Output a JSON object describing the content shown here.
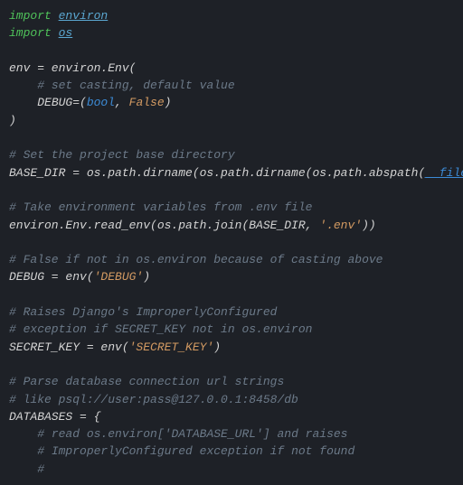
{
  "code": {
    "l1_import": "import",
    "l1_mod": "environ",
    "l2_import": "import",
    "l2_mod": "os",
    "l4_a": "env = environ.Env(",
    "l5_comment": "# set casting, default value",
    "l6_a": "DEBUG=(",
    "l6_bool": "bool",
    "l6_sep": ", ",
    "l6_false": "False",
    "l6_close": ")",
    "l7_close": ")",
    "l9_comment": "# Set the project base directory",
    "l10_a": "BASE_DIR = os.path.dirname(os.path.dirname(os.path.abspath(",
    "l10_file": "__file__",
    "l10_b": ")))",
    "l12_comment": "# Take environment variables from .env file",
    "l13_a": "environ.Env.read_env(os.path.join(BASE_DIR, ",
    "l13_str": "'.env'",
    "l13_b": "))",
    "l15_comment": "# False if not in os.environ because of casting above",
    "l16_a": "DEBUG = env(",
    "l16_str": "'DEBUG'",
    "l16_b": ")",
    "l18_comment": "# Raises Django's ImproperlyConfigured",
    "l19_comment": "# exception if SECRET_KEY not in os.environ",
    "l20_a": "SECRET_KEY = env(",
    "l20_str": "'SECRET_KEY'",
    "l20_b": ")",
    "l22_comment": "# Parse database connection url strings",
    "l23_comment": "# like psql://user:pass@127.0.0.1:8458/db",
    "l24_a": "DATABASES = {",
    "l25_comment": "# read os.environ['DATABASE_URL'] and raises",
    "l26_comment": "# ImproperlyConfigured exception if not found",
    "l27_comment": "#"
  }
}
